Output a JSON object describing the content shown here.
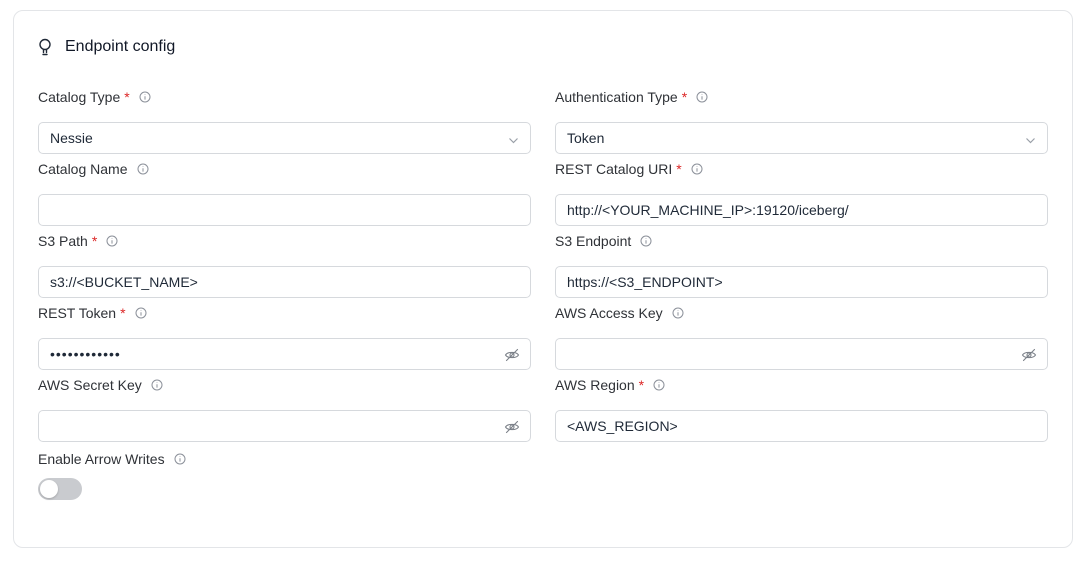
{
  "header": {
    "title": "Endpoint config"
  },
  "fields": {
    "catalog_type": {
      "label": "Catalog Type",
      "required": "*",
      "value": "Nessie"
    },
    "authentication_type": {
      "label": "Authentication Type",
      "required": "*",
      "value": "Token"
    },
    "catalog_name": {
      "label": "Catalog Name",
      "value": ""
    },
    "rest_catalog_uri": {
      "label": "REST Catalog URI",
      "required": "*",
      "value": "http://<YOUR_MACHINE_IP>:19120/iceberg/"
    },
    "s3_path": {
      "label": "S3 Path",
      "required": "*",
      "value": "s3://<BUCKET_NAME>"
    },
    "s3_endpoint": {
      "label": "S3 Endpoint",
      "value": "https://<S3_ENDPOINT>"
    },
    "rest_token": {
      "label": "REST Token",
      "required": "*",
      "value": "••••••••••••"
    },
    "aws_access_key": {
      "label": "AWS Access Key",
      "value": ""
    },
    "aws_secret_key": {
      "label": "AWS Secret Key",
      "value": ""
    },
    "aws_region": {
      "label": "AWS Region",
      "required": "*",
      "value": "<AWS_REGION>"
    },
    "enable_arrow_writes": {
      "label": "Enable Arrow Writes",
      "enabled": false
    }
  },
  "icons": {
    "header": "lightbulb-icon",
    "info": "info-icon",
    "dropdown": "chevron-down-icon",
    "password": "eye-off-icon"
  },
  "colors": {
    "required": "#dc2626",
    "toggle_off": "#c9cbcf",
    "border": "#d6d9dd"
  }
}
